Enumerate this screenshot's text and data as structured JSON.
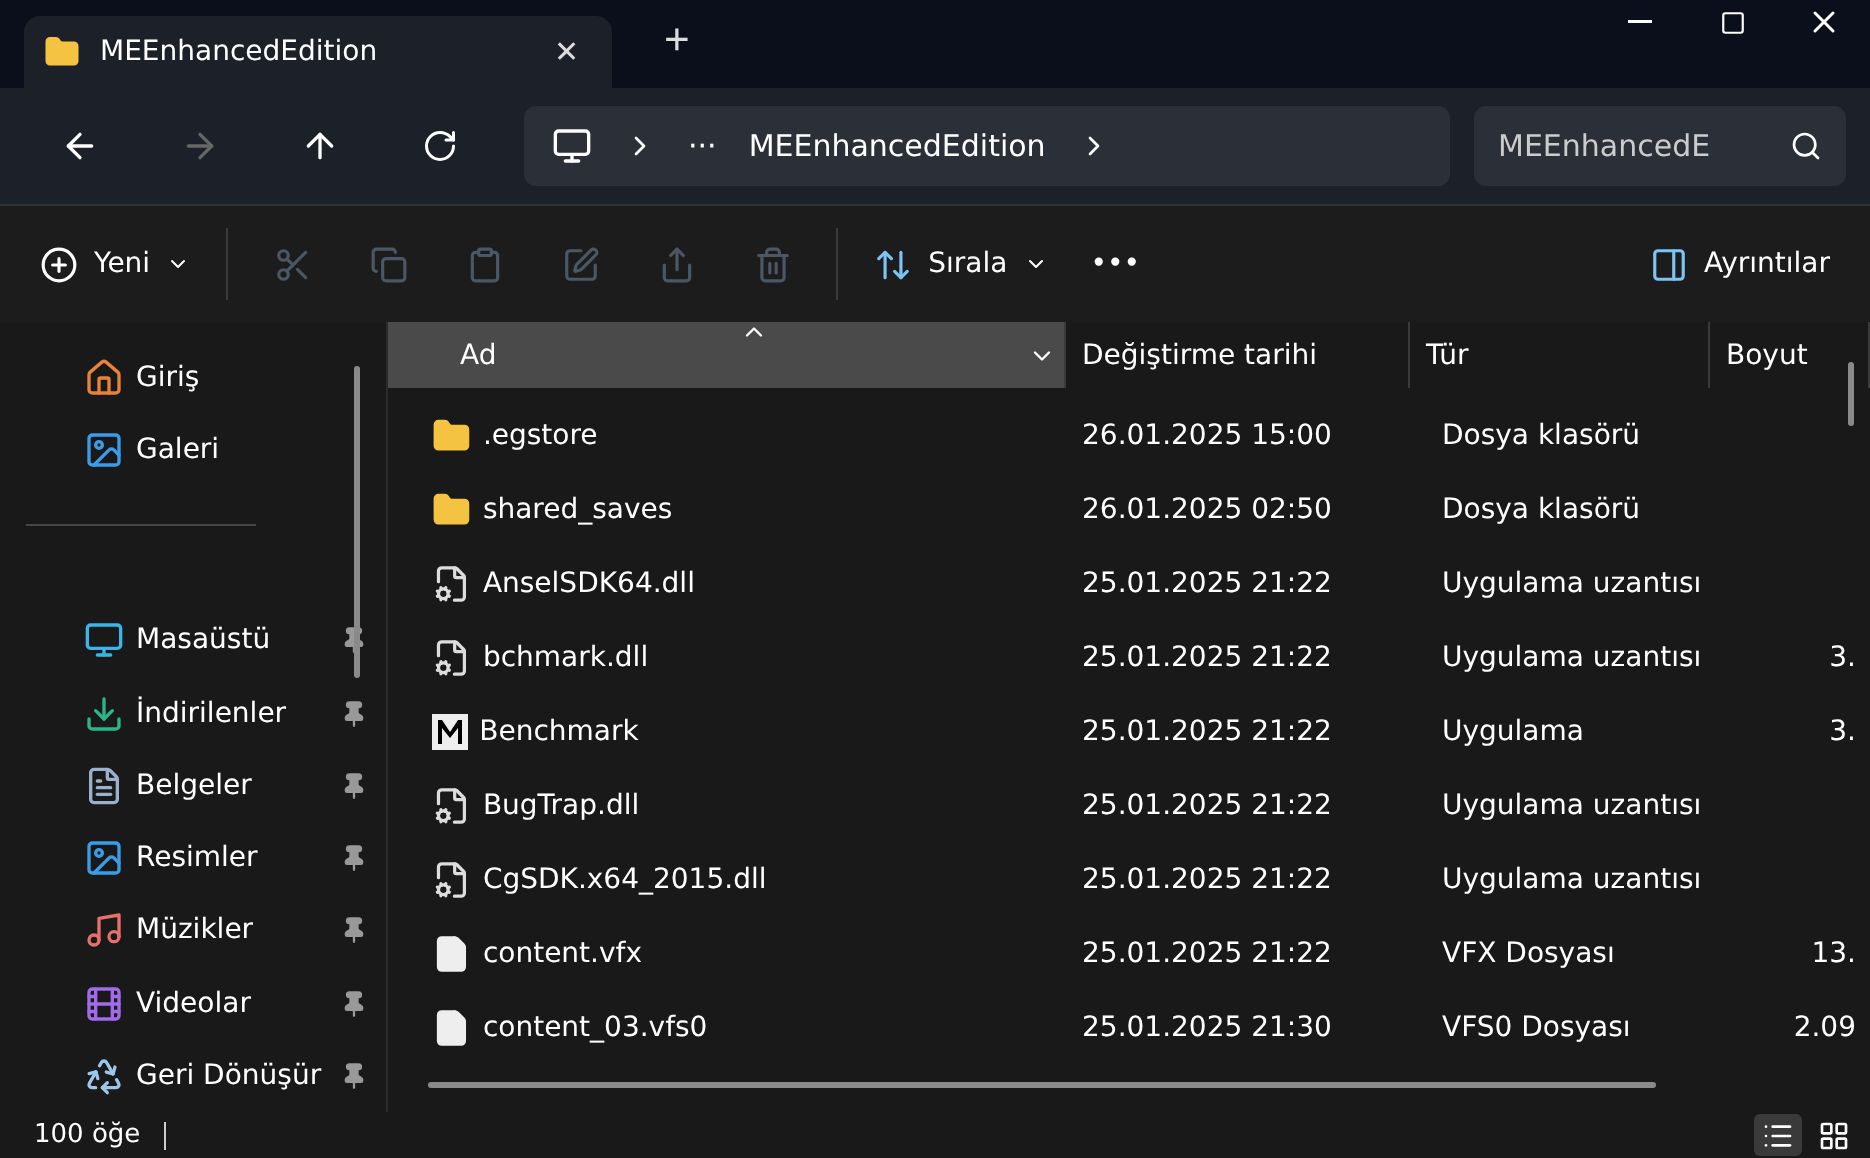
{
  "tab": {
    "title": "MEEnhancedEdition",
    "close": "✕",
    "new_tab": "+"
  },
  "address": {
    "overflow": "···",
    "folder": "MEEnhancedEdition",
    "search_value": "MEEnhancedE"
  },
  "toolbar": {
    "new_label": "Yeni",
    "sort_label": "Sırala",
    "more": "•••",
    "details_label": "Ayrıntılar",
    "actions": [
      {
        "kind": "cut",
        "disabled": true
      },
      {
        "kind": "copy",
        "disabled": true
      },
      {
        "kind": "paste",
        "disabled": true
      },
      {
        "kind": "rename",
        "disabled": true
      },
      {
        "kind": "share",
        "disabled": true
      },
      {
        "kind": "delete",
        "disabled": true
      }
    ]
  },
  "sidebar": {
    "items": [
      {
        "label": "Giriş",
        "kind": "home",
        "pinned": false
      },
      {
        "label": "Galeri",
        "kind": "gallery",
        "pinned": false
      },
      {
        "kind": "divider"
      },
      {
        "label": "Masaüstü",
        "kind": "desktop",
        "pinned": true
      },
      {
        "label": "İndirilenler",
        "kind": "download",
        "pinned": true
      },
      {
        "label": "Belgeler",
        "kind": "docs",
        "pinned": true
      },
      {
        "label": "Resimler",
        "kind": "pictures",
        "pinned": true
      },
      {
        "label": "Müzikler",
        "kind": "music",
        "pinned": true
      },
      {
        "label": "Videolar",
        "kind": "videos",
        "pinned": true
      },
      {
        "label": "Geri Dönüşür",
        "kind": "recycle",
        "pinned": true
      }
    ]
  },
  "table": {
    "columns": [
      {
        "label": "Ad",
        "selected": true
      },
      {
        "label": "Değiştirme tarihi",
        "selected": false
      },
      {
        "label": "Tür",
        "selected": false
      },
      {
        "label": "Boyut",
        "selected": false
      }
    ],
    "rows": [
      {
        "name": ".egstore",
        "kind": "folder",
        "date": "26.01.2025 15:00",
        "type": "Dosya klasörü",
        "size": ""
      },
      {
        "name": "shared_saves",
        "kind": "folder",
        "date": "26.01.2025 02:50",
        "type": "Dosya klasörü",
        "size": ""
      },
      {
        "name": "AnselSDK64.dll",
        "kind": "dll",
        "date": "25.01.2025 21:22",
        "type": "Uygulama uzantısı",
        "size": ""
      },
      {
        "name": "bchmark.dll",
        "kind": "dll",
        "date": "25.01.2025 21:22",
        "type": "Uygulama uzantısı",
        "size": "3."
      },
      {
        "name": "Benchmark",
        "kind": "app",
        "date": "25.01.2025 21:22",
        "type": "Uygulama",
        "size": "3."
      },
      {
        "name": "BugTrap.dll",
        "kind": "dll",
        "date": "25.01.2025 21:22",
        "type": "Uygulama uzantısı",
        "size": ""
      },
      {
        "name": "CgSDK.x64_2015.dll",
        "kind": "dll",
        "date": "25.01.2025 21:22",
        "type": "Uygulama uzantısı",
        "size": ""
      },
      {
        "name": "content.vfx",
        "kind": "file",
        "date": "25.01.2025 21:22",
        "type": "VFX Dosyası",
        "size": "13."
      },
      {
        "name": "content_03.vfs0",
        "kind": "file",
        "date": "25.01.2025 21:30",
        "type": "VFS0 Dosyası",
        "size": "2.09"
      }
    ]
  },
  "status_bar": {
    "count": "100 öğe",
    "views": [
      {
        "kind": "details",
        "selected": true
      },
      {
        "kind": "tiles",
        "selected": false
      }
    ]
  }
}
